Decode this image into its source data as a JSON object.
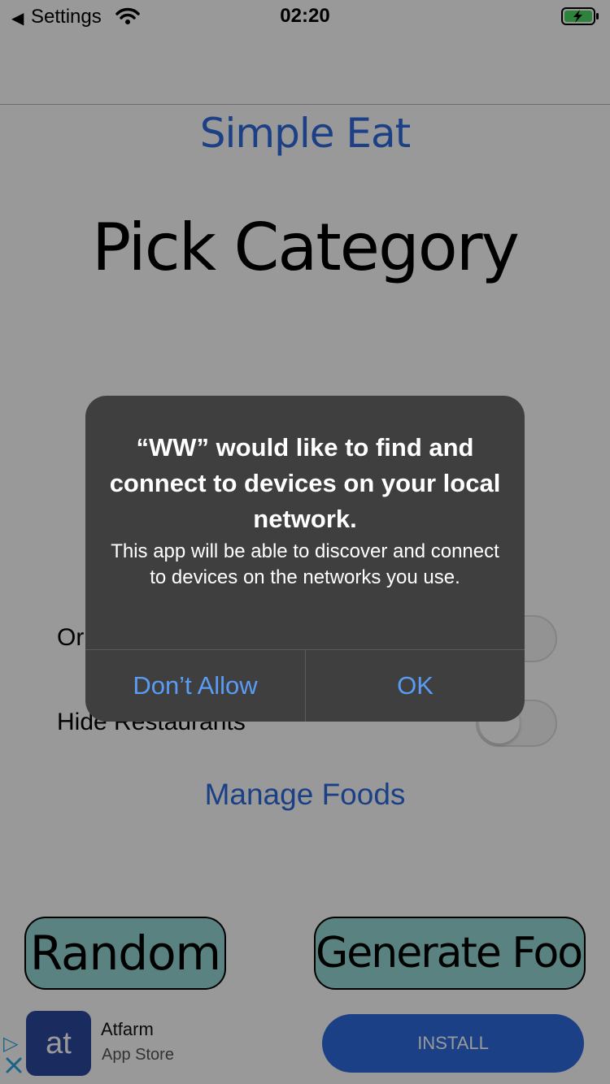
{
  "status_bar": {
    "back_label": "Settings",
    "time": "02:20"
  },
  "app": {
    "title": "Simple Eat",
    "heading": "Pick Category",
    "toggle_rows": [
      {
        "label": "Or",
        "on": false
      },
      {
        "label": "Hide Restaurants",
        "on": false
      }
    ],
    "manage_link": "Manage Foods",
    "random_button": "Random",
    "generate_button": "Generate Food"
  },
  "ad": {
    "icon_text": "at",
    "app_name": "Atfarm",
    "store": "App Store",
    "install_label": "INSTALL"
  },
  "alert": {
    "title": "“WW” would like to find and connect to devices on your local network.",
    "message": "This app will be able to discover and connect to devices on the networks you use.",
    "deny_label": "Don’t Allow",
    "ok_label": "OK"
  },
  "colors": {
    "accent": "#2f6cdf",
    "button_fill": "#94d9d6",
    "alert_bg": "#3f3f3f",
    "alert_button_text": "#5a9cf5",
    "battery_green": "#4cd964"
  },
  "icons": [
    "back-arrow-icon",
    "wifi-icon",
    "battery-charging-icon",
    "ad-choices-icon",
    "close-icon"
  ]
}
